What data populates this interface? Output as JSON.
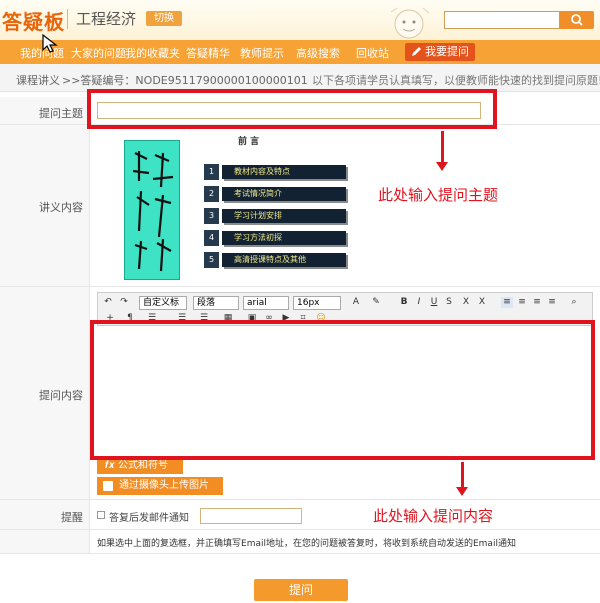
{
  "header": {
    "logo": "答疑板",
    "subject": "工程经济",
    "switch_label": "切换"
  },
  "nav": {
    "items": [
      "我的问题",
      "大家的问题",
      "我的收藏夹",
      "答疑精华",
      "教师提示",
      "高级搜索",
      "回收站"
    ],
    "ask_label": "我要提问"
  },
  "breadcrumb": {
    "section": "课程讲义",
    "node_id": ">>答疑编号：NODE95117900000100000101",
    "tip": "以下各项请学员认真填写，以便教师能快速的找到提问原题!"
  },
  "form": {
    "title_label": "提问主题",
    "lecture_label": "讲义内容",
    "content_label": "提问内容",
    "remind_label": "提醒"
  },
  "preview": {
    "heading": "前  言",
    "items": [
      {
        "num": "1",
        "text": "教材内容及特点"
      },
      {
        "num": "2",
        "text": "考试情况简介"
      },
      {
        "num": "3",
        "text": "学习计划安排"
      },
      {
        "num": "4",
        "text": "学习方法初探"
      },
      {
        "num": "5",
        "text": "高清授课特点及其他"
      }
    ]
  },
  "editor": {
    "style_select": "自定义标",
    "paragraph_select": "段落",
    "font_select": "arial",
    "size_select": "16px",
    "formula_label": "公式和符号",
    "camera_label": "通过摄像头上传图片"
  },
  "remind": {
    "checkbox_label": "答复后发邮件通知",
    "note": "如果选中上面的复选框，并正确填写Email地址，在您的问题被答复时，将收到系统自动发送的Email通知"
  },
  "submit_label": "提问",
  "annotations": {
    "title_hint": "此处输入提问主题",
    "content_hint": "此处输入提问内容"
  },
  "colors": {
    "brand_orange": "#f6a234",
    "annotation_red": "#e0141f"
  }
}
